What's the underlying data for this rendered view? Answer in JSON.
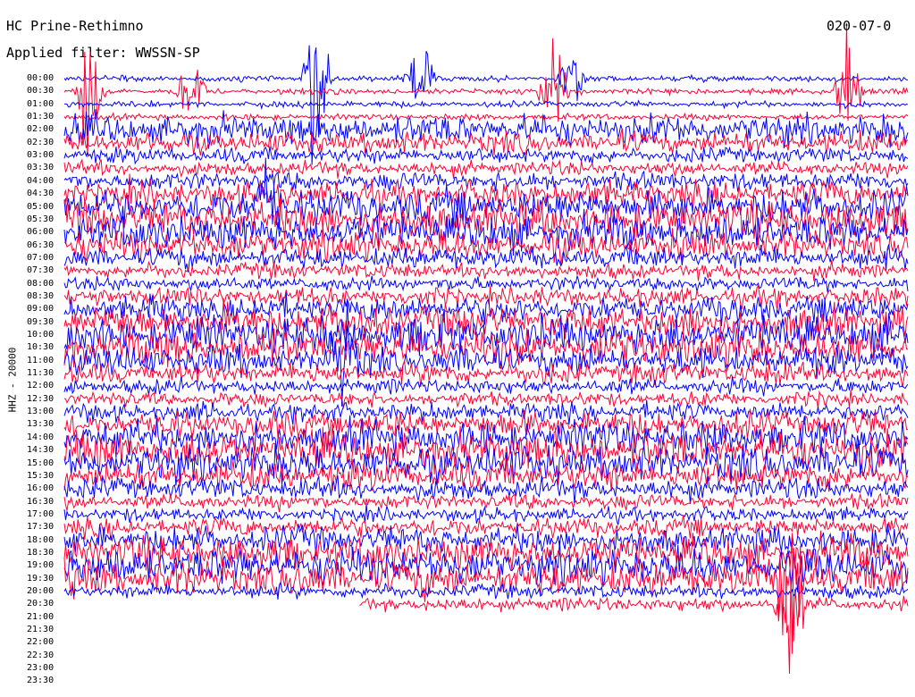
{
  "header": {
    "station": "HC Prine-Rethimno",
    "filter": "Applied filter: WWSSN-SP",
    "date": "020-07-0"
  },
  "channel_label": "HHZ - 20000",
  "chart_data": {
    "type": "seismogram",
    "rows": [
      {
        "time": "00:00",
        "color": "#0000ff"
      },
      {
        "time": "00:30",
        "color": "#ff0033"
      },
      {
        "time": "01:00",
        "color": "#0000ff"
      },
      {
        "time": "01:30",
        "color": "#ff0033"
      },
      {
        "time": "02:00",
        "color": "#0000ff"
      },
      {
        "time": "02:30",
        "color": "#ff0033"
      },
      {
        "time": "03:00",
        "color": "#0000ff"
      },
      {
        "time": "03:30",
        "color": "#ff0033"
      },
      {
        "time": "04:00",
        "color": "#0000ff"
      },
      {
        "time": "04:30",
        "color": "#ff0033"
      },
      {
        "time": "05:00",
        "color": "#0000ff"
      },
      {
        "time": "05:30",
        "color": "#ff0033"
      },
      {
        "time": "06:00",
        "color": "#0000ff"
      },
      {
        "time": "06:30",
        "color": "#ff0033"
      },
      {
        "time": "07:00",
        "color": "#0000ff"
      },
      {
        "time": "07:30",
        "color": "#ff0033"
      },
      {
        "time": "08:00",
        "color": "#0000ff"
      },
      {
        "time": "08:30",
        "color": "#ff0033"
      },
      {
        "time": "09:00",
        "color": "#0000ff"
      },
      {
        "time": "09:30",
        "color": "#ff0033"
      },
      {
        "time": "10:00",
        "color": "#0000ff"
      },
      {
        "time": "10:30",
        "color": "#ff0033"
      },
      {
        "time": "11:00",
        "color": "#0000ff"
      },
      {
        "time": "11:30",
        "color": "#ff0033"
      },
      {
        "time": "12:00",
        "color": "#0000ff"
      },
      {
        "time": "12:30",
        "color": "#ff0033"
      },
      {
        "time": "13:00",
        "color": "#0000ff"
      },
      {
        "time": "13:30",
        "color": "#ff0033"
      },
      {
        "time": "14:00",
        "color": "#0000ff"
      },
      {
        "time": "14:30",
        "color": "#ff0033"
      },
      {
        "time": "15:00",
        "color": "#0000ff"
      },
      {
        "time": "15:30",
        "color": "#ff0033"
      },
      {
        "time": "16:00",
        "color": "#0000ff"
      },
      {
        "time": "16:30",
        "color": "#ff0033"
      },
      {
        "time": "17:00",
        "color": "#0000ff"
      },
      {
        "time": "17:30",
        "color": "#ff0033"
      },
      {
        "time": "18:00",
        "color": "#0000ff"
      },
      {
        "time": "18:30",
        "color": "#ff0033"
      },
      {
        "time": "19:00",
        "color": "#0000ff"
      },
      {
        "time": "19:30",
        "color": "#ff0033"
      },
      {
        "time": "20:00",
        "color": "#0000ff"
      },
      {
        "time": "20:30",
        "color": "#ff0033"
      },
      {
        "time": "21:00",
        "color": "#0000ff"
      },
      {
        "time": "21:30",
        "color": "#ff0033"
      },
      {
        "time": "22:00",
        "color": "#0000ff"
      },
      {
        "time": "22:30",
        "color": "#ff0033"
      },
      {
        "time": "23:00",
        "color": "#0000ff"
      },
      {
        "time": "23:30",
        "color": "#ff0033"
      }
    ],
    "recorded_through": "20:30",
    "events": [
      {
        "row": "00:00",
        "x_fraction": 0.3,
        "strength": 1.0
      },
      {
        "row": "00:00",
        "x_fraction": 0.42,
        "strength": 0.6
      },
      {
        "row": "00:00",
        "x_fraction": 0.6,
        "strength": 0.4
      },
      {
        "row": "00:30",
        "x_fraction": 0.03,
        "strength": 0.7
      },
      {
        "row": "00:30",
        "x_fraction": 0.15,
        "strength": 0.5
      },
      {
        "row": "00:30",
        "x_fraction": 0.58,
        "strength": 0.5
      },
      {
        "row": "00:30",
        "x_fraction": 0.93,
        "strength": 1.0
      },
      {
        "row": "05:00",
        "x_fraction": 0.24,
        "strength": 0.6
      },
      {
        "row": "11:00",
        "x_fraction": 0.33,
        "strength": 0.6
      },
      {
        "row": "19:30",
        "x_fraction": 0.86,
        "strength": 1.0
      },
      {
        "row": "20:30",
        "x_fraction": 0.86,
        "strength": 1.0
      }
    ]
  }
}
